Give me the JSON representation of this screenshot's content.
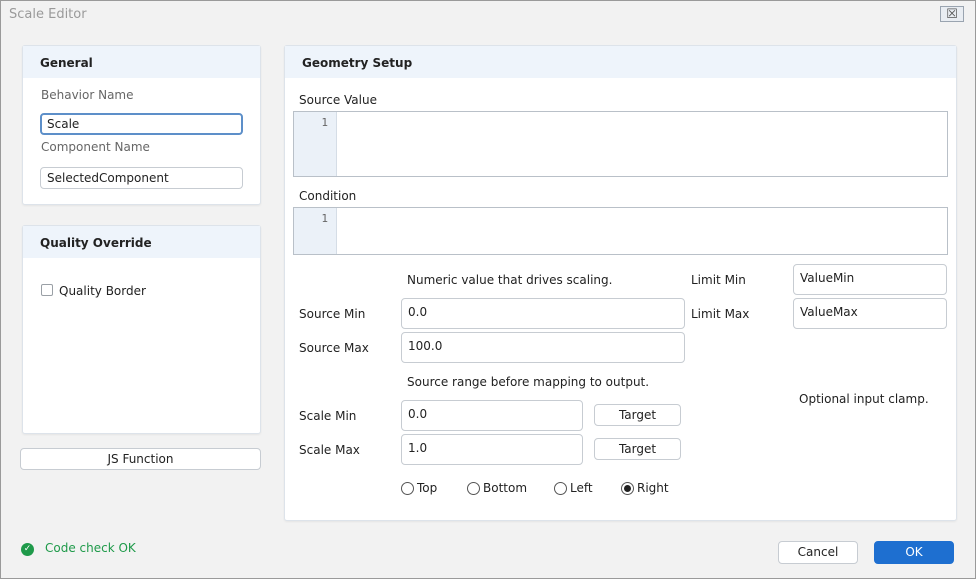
{
  "window": {
    "title": "Scale Editor",
    "close_glyph": "☒"
  },
  "general": {
    "header": "General",
    "behavior_name_label": "Behavior Name",
    "behavior_name_value": "Scale",
    "component_name_label": "Component Name",
    "component_name_value": "SelectedComponent"
  },
  "quality": {
    "header": "Quality Override",
    "checkbox_label": "Quality Border",
    "checked": false
  },
  "js_function_label": "JS Function",
  "geometry": {
    "header": "Geometry Setup",
    "source_value_label": "Source Value",
    "source_value_line": "1",
    "condition_label": "Condition",
    "condition_line": "1",
    "numeric_hint": "Numeric value that drives scaling.",
    "source_min_label": "Source Min",
    "source_min_value": "0.0",
    "source_max_label": "Source Max",
    "source_max_value": "100.0",
    "range_hint": "Source range before mapping to output.",
    "scale_min_label": "Scale Min",
    "scale_min_value": "0.0",
    "scale_max_label": "Scale Max",
    "scale_max_value": "1.0",
    "target_label_1": "Target",
    "target_label_2": "Target",
    "limit_min_label": "Limit Min",
    "limit_min_value": "ValueMin",
    "limit_max_label": "Limit Max",
    "limit_max_value": "ValueMax",
    "clamp_hint": "Optional input clamp.",
    "radios": [
      {
        "label": "Top",
        "selected": false
      },
      {
        "label": "Bottom",
        "selected": false
      },
      {
        "label": "Left",
        "selected": false
      },
      {
        "label": "Right",
        "selected": true
      }
    ]
  },
  "status": {
    "text": "Code check OK",
    "icon": "check-circle-icon",
    "color": "#1f9a4a"
  },
  "footer": {
    "cancel_label": "Cancel",
    "ok_label": "OK"
  },
  "colors": {
    "accent": "#1e6fd0",
    "panel_header": "#eef4fb"
  }
}
